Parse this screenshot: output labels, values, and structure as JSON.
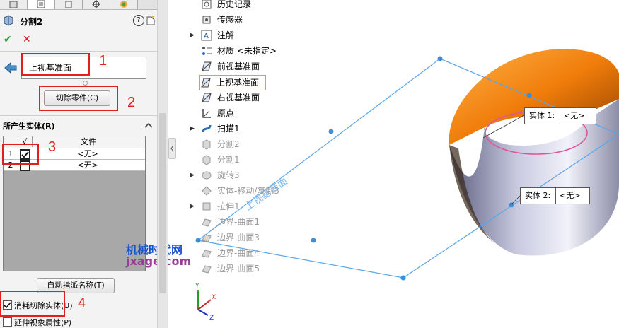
{
  "panel": {
    "title": "分割2",
    "help_label": "?",
    "ok_label": "✔",
    "cancel_label": "✕",
    "plane_field_value": "上视基准面",
    "trim_button_label": "切除零件(C)",
    "section_title": "所产生实体(R)",
    "table": {
      "col_check": "√",
      "col_file": "文件",
      "rows": [
        {
          "index": "1",
          "checked": true,
          "file": "<无>"
        },
        {
          "index": "2",
          "checked": false,
          "file": "<无>"
        }
      ]
    },
    "auto_name_button": "自动指派名称(T)",
    "consume_label": "消耗切除实体(U)",
    "propagate_label": "延伸视象属性(P)"
  },
  "annotations": [
    "1",
    "2",
    "3",
    "4"
  ],
  "watermark": {
    "line1": "机械时代网",
    "line2": "jxage.com"
  },
  "tree": [
    {
      "label": "历史记录",
      "icon": "history-icon",
      "expand": false,
      "dim": false
    },
    {
      "label": "传感器",
      "icon": "sensor-icon",
      "expand": false,
      "dim": false
    },
    {
      "label": "注解",
      "icon": "annotation-icon",
      "expand": true,
      "dim": false
    },
    {
      "label": "材质 <未指定>",
      "icon": "material-icon",
      "expand": false,
      "dim": false
    },
    {
      "label": "前视基准面",
      "icon": "plane-icon",
      "expand": false,
      "dim": false
    },
    {
      "label": "上视基准面",
      "icon": "plane-icon",
      "expand": false,
      "dim": false,
      "selected": true
    },
    {
      "label": "右视基准面",
      "icon": "plane-icon",
      "expand": false,
      "dim": false
    },
    {
      "label": "原点",
      "icon": "origin-icon",
      "expand": false,
      "dim": false
    },
    {
      "label": "扫描1",
      "icon": "sweep-icon",
      "expand": true,
      "dim": false
    },
    {
      "label": "分割2",
      "icon": "split-icon",
      "expand": false,
      "dim": true
    },
    {
      "label": "分割1",
      "icon": "split-icon",
      "expand": false,
      "dim": true
    },
    {
      "label": "旋转3",
      "icon": "revolve-icon",
      "expand": true,
      "dim": true
    },
    {
      "label": "实体-移动/复制3",
      "icon": "move-body-icon",
      "expand": false,
      "dim": true
    },
    {
      "label": "拉伸1",
      "icon": "extrude-icon",
      "expand": true,
      "dim": true
    },
    {
      "label": "边界-曲面1",
      "icon": "surface-icon",
      "expand": false,
      "dim": true
    },
    {
      "label": "边界-曲面3",
      "icon": "surface-icon",
      "expand": false,
      "dim": true
    },
    {
      "label": "边界-曲面4",
      "icon": "surface-icon",
      "expand": false,
      "dim": true
    },
    {
      "label": "边界-曲面5",
      "icon": "surface-icon",
      "expand": false,
      "dim": true
    }
  ],
  "viewport": {
    "plane_label": "上视基准面",
    "callouts": [
      {
        "text": "实体 1:",
        "value": "<无>"
      },
      {
        "text": "实体 2:",
        "value": "<无>"
      }
    ],
    "triad_x": "X",
    "triad_y": "Y",
    "triad_z": "Z"
  },
  "colors": {
    "accent": "#3b8fd9",
    "orange": "#f07d0a",
    "annotation": "#e02020",
    "watermark_blue": "#1550d0",
    "watermark_purple": "#9a3a9a"
  }
}
